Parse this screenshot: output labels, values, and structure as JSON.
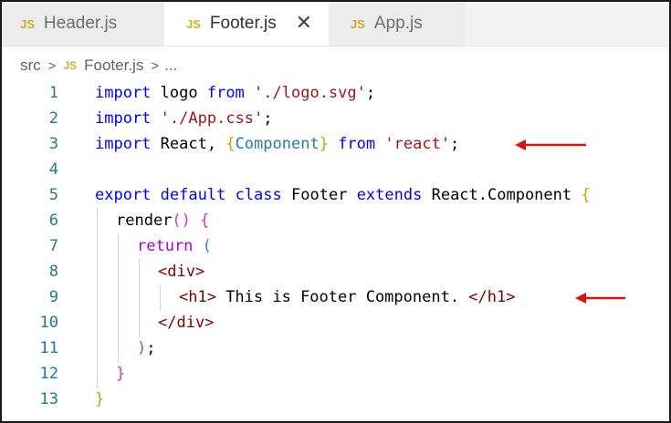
{
  "tabs": [
    {
      "lang": "JS",
      "label": "Header.js",
      "active": false
    },
    {
      "lang": "JS",
      "label": "Footer.js",
      "active": true,
      "close": "✕"
    },
    {
      "lang": "JS",
      "label": "App.js",
      "active": false
    }
  ],
  "breadcrumb": {
    "folder": "src",
    "sep": ">",
    "lang": "JS",
    "file": "Footer.js",
    "more": "..."
  },
  "line_numbers": [
    "1",
    "2",
    "3",
    "4",
    "5",
    "6",
    "7",
    "8",
    "9",
    "10",
    "11",
    "12",
    "13"
  ],
  "code": {
    "l1": {
      "kw": "import",
      "a": " logo ",
      "kw2": "from",
      "sp": " ",
      "str": "'./logo.svg'",
      "end": ";"
    },
    "l2": {
      "kw": "import",
      "sp": " ",
      "str": "'./App.css'",
      "end": ";"
    },
    "l3": {
      "kw": "import",
      "a": " React, ",
      "b1": "{",
      "comp": "Component",
      "b2": "}",
      "sp": " ",
      "kw2": "from",
      "sp2": " ",
      "str": "'react'",
      "end": ";"
    },
    "l5": {
      "kw1": "export",
      "kw2": "default",
      "kw3": "class",
      "name": "Footer",
      "kw4": "extends",
      "parent": "React.Component",
      "brace": "{"
    },
    "l6": {
      "fn": "render",
      "paren": "()",
      "sp": " ",
      "brace": "{"
    },
    "l7": {
      "kw": "return",
      "sp": " ",
      "paren": "("
    },
    "l8": {
      "tag": "<div>"
    },
    "l9": {
      "open": "<h1>",
      "text": " This is Footer Component. ",
      "close": "</h1>"
    },
    "l10": {
      "tag": "</div>"
    },
    "l11": {
      "paren": ")",
      "end": ";"
    },
    "l12": {
      "brace": "}"
    },
    "l13": {
      "brace": "}"
    }
  },
  "colors": {
    "keyword": "#0000ff",
    "control": "#af00db",
    "string": "#a31515",
    "tag": "#800000",
    "line_number": "#237893",
    "arrow": "#e01010",
    "js_icon": "#c9b026"
  }
}
